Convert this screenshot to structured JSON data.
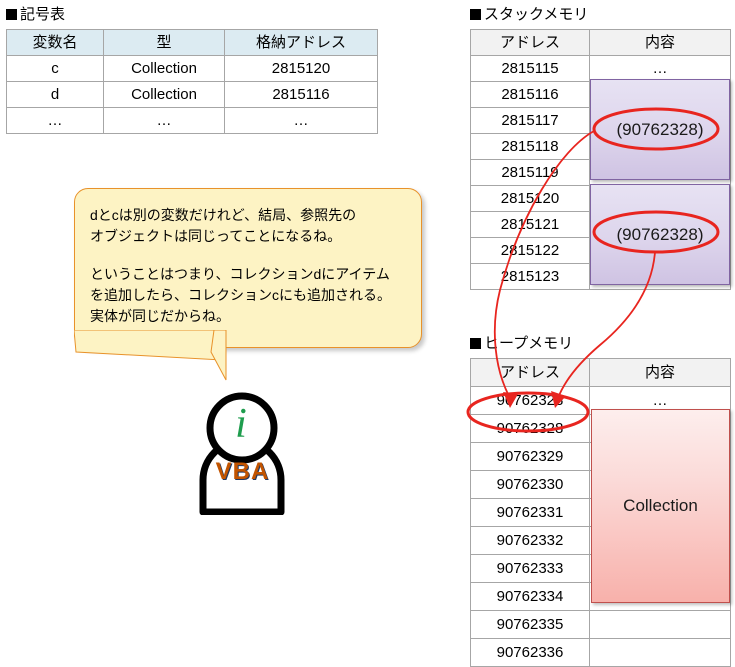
{
  "symbol_table": {
    "title": "■記号表",
    "headers": [
      "変数名",
      "型",
      "格納アドレス"
    ],
    "rows": [
      [
        "c",
        "Collection",
        "2815120"
      ],
      [
        "d",
        "Collection",
        "2815116"
      ],
      [
        "…",
        "…",
        "…"
      ]
    ]
  },
  "stack_memory": {
    "title": "■スタックメモリ",
    "headers": [
      "アドレス",
      "内容"
    ],
    "rows": [
      {
        "address": "2815115",
        "content": "…"
      },
      {
        "address": "2815116",
        "content": ""
      },
      {
        "address": "2815117",
        "content": ""
      },
      {
        "address": "2815118",
        "content": ""
      },
      {
        "address": "2815119",
        "content": ""
      },
      {
        "address": "2815120",
        "content": ""
      },
      {
        "address": "2815121",
        "content": ""
      },
      {
        "address": "2815122",
        "content": ""
      },
      {
        "address": "2815123",
        "content": ""
      }
    ],
    "boxes": [
      {
        "value": "(90762328)"
      },
      {
        "value": "(90762328)"
      }
    ]
  },
  "heap_memory": {
    "title": "■ヒープメモリ",
    "headers": [
      "アドレス",
      "内容"
    ],
    "rows": [
      {
        "address": "90762328",
        "content": "…"
      },
      {
        "address": "90762328",
        "content": ""
      },
      {
        "address": "90762329",
        "content": ""
      },
      {
        "address": "90762330",
        "content": ""
      },
      {
        "address": "90762331",
        "content": ""
      },
      {
        "address": "90762332",
        "content": ""
      },
      {
        "address": "90762333",
        "content": ""
      },
      {
        "address": "90762334",
        "content": ""
      },
      {
        "address": "90762335",
        "content": ""
      },
      {
        "address": "90762336",
        "content": ""
      }
    ],
    "box": {
      "label": "Collection"
    }
  },
  "speech_bubble": {
    "paragraph1_line1": "dとcは別の変数だけれど、結局、参照先の",
    "paragraph1_line2": "オブジェクトは同じってことになるね。",
    "paragraph2_line1": "ということはつまり、コレクションdにアイテム",
    "paragraph2_line2": "を追加したら、コレクションcにも追加される。",
    "paragraph2_line3": "実体が同じだからね。"
  },
  "mascot": {
    "info_letter": "i",
    "label": "VBA"
  },
  "colors": {
    "symbol_header_fill": "#dcebf2",
    "memory_header_fill": "#f2f2f2",
    "grid_border": "#a6a6a6",
    "stack_box_border": "#8064a2",
    "heap_box_border": "#c0504d",
    "annotation_red": "#e8251f",
    "bubble_fill": "#fdf3c4",
    "bubble_border": "#e8922a",
    "mascot_green": "#1f9d4e",
    "mascot_orange": "#c25400"
  }
}
